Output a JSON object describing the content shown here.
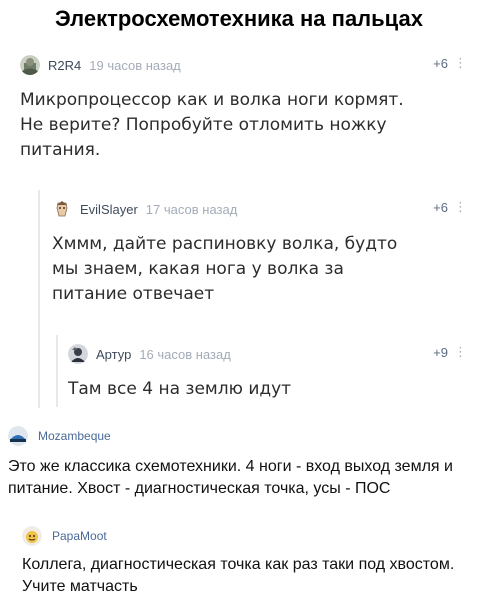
{
  "page_title": "Электросхемотехника на пальцах",
  "thread": [
    {
      "author": "R2R4",
      "time": "19 часов назад",
      "score": "+6",
      "more": "⋮",
      "text": "Микропроцессор как и волка ноги кормят. Не верите? Попробуйте отломить ножку питания."
    },
    {
      "author": "EvilSlayer",
      "time": "17 часов назад",
      "score": "+6",
      "more": "⋮",
      "text": "Хммм, дайте распиновку волка, будто мы знаем, какая нога у волка за питание отвечает"
    },
    {
      "author": "Артур",
      "time": "16 часов назад",
      "score": "+9",
      "more": "⋮",
      "text": "Там все 4 на землю идут"
    }
  ],
  "replies": [
    {
      "author": "Mozambeque",
      "text": "Это же классика схемотехники. 4 ноги - вход выход земля и питание. Хвост - диагностическая точка, усы - ПОС"
    },
    {
      "author": "PapaMoot",
      "text": "Коллега, диагностическая точка как раз таки под хвостом. Учите матчасть"
    }
  ],
  "colors": {
    "rail": "#e5e8ed",
    "meta_gray": "#a3acb8",
    "author_dark": "#3e4a5c",
    "vk_link": "#4a6a9a"
  }
}
